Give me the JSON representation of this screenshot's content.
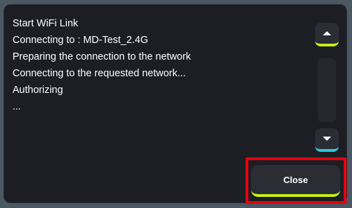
{
  "log": {
    "lines": [
      "Start WiFi Link",
      "Connecting to : MD-Test_2.4G",
      "Preparing the connection to the network",
      "Connecting to the requested network...",
      "Authorizing",
      "..."
    ]
  },
  "scrollbar": {
    "up_icon": "chevron-up-icon",
    "down_icon": "chevron-down-icon",
    "up_accent": "#c6ef1c",
    "down_accent": "#2ec9d8"
  },
  "actions": {
    "close_label": "Close",
    "close_accent": "#c6ef1c",
    "highlight_color": "#e8000e"
  }
}
